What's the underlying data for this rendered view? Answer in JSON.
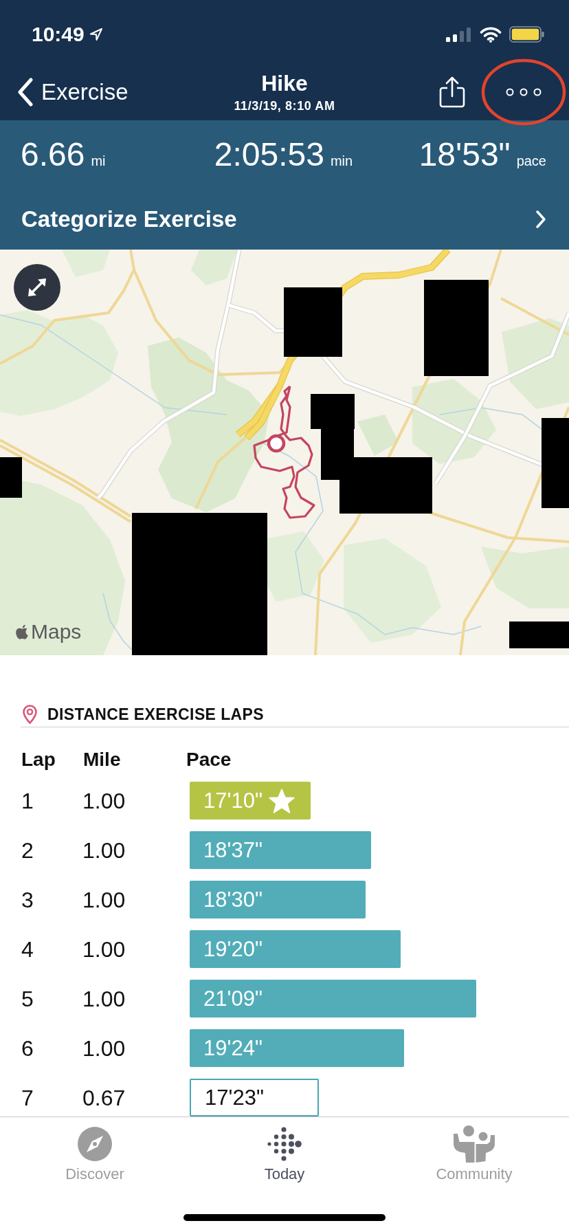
{
  "status_bar": {
    "time": "10:49"
  },
  "nav_bar": {
    "back_label": "Exercise",
    "title": "Hike",
    "subtitle": "11/3/19, 8:10 AM",
    "more_button": {
      "circled": true
    }
  },
  "summary": {
    "stats": [
      {
        "value": "6.66",
        "unit": "mi"
      },
      {
        "value": "2:05:53",
        "unit": "min"
      },
      {
        "value": "18'53\"",
        "unit": "pace"
      }
    ],
    "categorize": {
      "label": "Categorize Exercise"
    }
  },
  "map": {
    "attribution": "Maps"
  },
  "laps": {
    "title": "DISTANCE EXERCISE LAPS",
    "columns": [
      "Lap",
      "Mile",
      "Pace"
    ],
    "rows": [
      {
        "lap": "1",
        "mile": "1.00",
        "pace": "17'10\"",
        "kind": "best",
        "level": 0.319
      },
      {
        "lap": "2",
        "mile": "1.00",
        "pace": "18'37\"",
        "kind": "lap",
        "level": 0.478
      },
      {
        "lap": "3",
        "mile": "1.00",
        "pace": "18'30\"",
        "kind": "lap",
        "level": 0.464
      },
      {
        "lap": "4",
        "mile": "1.00",
        "pace": "19'20\"",
        "kind": "lap",
        "level": 0.556
      },
      {
        "lap": "5",
        "mile": "1.00",
        "pace": "21'09\"",
        "kind": "lap",
        "level": 0.755
      },
      {
        "lap": "6",
        "mile": "1.00",
        "pace": "19'24\"",
        "kind": "lap",
        "level": 0.565
      },
      {
        "lap": "7",
        "mile": "0.67",
        "pace": "17'23\"",
        "kind": "partial",
        "level": 0.341
      }
    ]
  },
  "tab_bar": {
    "tabs": [
      {
        "label": "Discover",
        "selected": false
      },
      {
        "label": "Today",
        "selected": true
      },
      {
        "label": "Community",
        "selected": false
      }
    ]
  }
}
